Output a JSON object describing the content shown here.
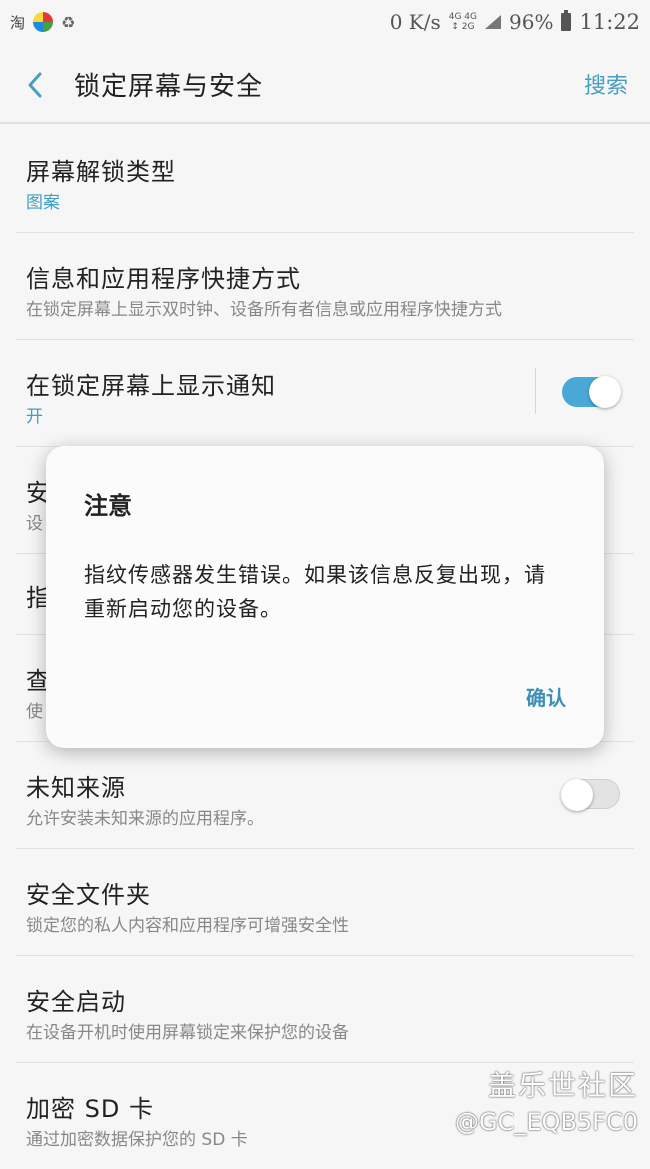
{
  "status_bar": {
    "app_glyph": "淘",
    "speed": "0 K/s",
    "net_top": "4G 4G",
    "net_bottom": "↕ 2G",
    "battery": "96%",
    "time": "11:22"
  },
  "app_bar": {
    "title": "锁定屏幕与安全",
    "search": "搜索"
  },
  "settings": [
    {
      "title": "屏幕解锁类型",
      "subtitle": "图案"
    },
    {
      "title": "信息和应用程序快捷方式",
      "subtitle": "在锁定屏幕上显示双时钟、设备所有者信息或应用程序快捷方式"
    },
    {
      "title": "在锁定屏幕上显示通知",
      "subtitle": "开",
      "toggle_on": true
    },
    {
      "title": "安",
      "subtitle": "设"
    },
    {
      "title": "指"
    },
    {
      "title": "查",
      "subtitle": "使"
    },
    {
      "title": "未知来源",
      "subtitle": "允许安装未知来源的应用程序。",
      "toggle_on": false
    },
    {
      "title": "安全文件夹",
      "subtitle": "锁定您的私人内容和应用程序可增强安全性"
    },
    {
      "title": "安全启动",
      "subtitle": "在设备开机时使用屏幕锁定来保护您的设备"
    },
    {
      "title": "加密 SD 卡",
      "subtitle": "通过加密数据保护您的 SD 卡"
    }
  ],
  "dialog": {
    "title": "注意",
    "message": "指纹传感器发生错误。如果该信息反复出现，请重新启动您的设备。",
    "confirm": "确认"
  },
  "watermark": {
    "line1": "盖乐世社区",
    "line2": "@GC_EQB5FC0"
  },
  "colors": {
    "accent": "#4aa8d6",
    "link": "#4a9dc0",
    "background": "#f6f6f6"
  }
}
